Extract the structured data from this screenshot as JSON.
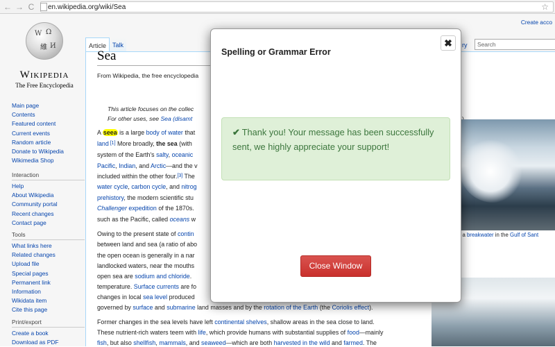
{
  "browser": {
    "url": "en.wikipedia.org/wiki/Sea",
    "back": "←",
    "forward": "→",
    "reload": "C",
    "star": "☆"
  },
  "header": {
    "create_account": "Create acco",
    "search_placeholder": "Search"
  },
  "logo": {
    "wordmark": "Wikipedia",
    "tagline": "The Free Encyclopedia"
  },
  "tabs": {
    "article": "Article",
    "talk": "Talk",
    "history": "ry"
  },
  "sidebar": {
    "main": [
      "Main page",
      "Contents",
      "Featured content",
      "Current events",
      "Random article",
      "Donate to Wikipedia",
      "Wikimedia Shop"
    ],
    "interaction_head": "Interaction",
    "interaction": [
      "Help",
      "About Wikipedia",
      "Community portal",
      "Recent changes",
      "Contact page"
    ],
    "tools_head": "Tools",
    "tools": [
      "What links here",
      "Related changes",
      "Upload file",
      "Special pages",
      "Permanent link",
      "Information",
      "Wikidata item",
      "Cite this page"
    ],
    "print_head": "Print/export",
    "print": [
      "Create a book",
      "Download as PDF"
    ]
  },
  "article": {
    "title": "Sea",
    "from": "From Wikipedia, the free encyclopedia",
    "hatnote1": "This article focuses on the collec",
    "hatnote2a": "For other uses, see ",
    "hatnote2b": "Sea (disamt",
    "hatnote_end": ").",
    "lines": {
      "l1a": "A ",
      "l1hl": "seea",
      "l1b": " is a large ",
      "l1c": "body of water",
      "l1d": " that",
      "l2a": "land",
      "l2b": " [1]",
      "l2c": " More broadly, ",
      "l2d": "the sea",
      "l2e": " (with",
      "l3a": "system of the Earth's ",
      "l3b": "salty",
      "l3c": ", ",
      "l3d": "oceanic",
      "l4a": "Pacific",
      "l4b": ", ",
      "l4c": "Indian",
      "l4d": ", and ",
      "l4e": "Arctic",
      "l4f": "—and the v",
      "l5a": "included within the other four.",
      "l5b": "[3]",
      "l5c": " The",
      "l6a": "water cycle",
      "l6b": ", ",
      "l6c": "carbon cycle",
      "l6d": ", and ",
      "l6e": "nitrog",
      "l7a": "prehistory",
      "l7b": ", the modern scientific stu",
      "l8a": "Challenger",
      "l8b": " expedition",
      "l8c": " of the 1870s.",
      "l9a": "such as the Pacific, called ",
      "l9b": "oceans",
      "l9c": " w",
      "p2l1a": "Owing to the present state of ",
      "p2l1b": "contin",
      "p2l2": "between land and sea (a ratio of abo",
      "p2l3": "the open ocean is generally in a nar",
      "p2l4": "landlocked waters, near the mouths",
      "p2l5a": "open sea are ",
      "p2l5b": "sodium and chloride",
      "p2l5c": ". ",
      "p2l6a": "temperature. ",
      "p2l6b": "Surface currents",
      "p2l6c": " are fo",
      "p2l7a": "changes in local ",
      "p2l7b": "sea level",
      "p2l7c": " produced",
      "p2l8a": "governed by ",
      "p2l8b": "surface",
      "p2l8c": " and ",
      "p2l8d": "submarine",
      "p2l8e": " land masses and by the ",
      "p2l8f": "rotation of the Earth",
      "p2l8g": " (the ",
      "p2l8h": "Coriolis effect",
      "p2l8i": ").",
      "p3l1a": "Former changes in the sea levels have left ",
      "p3l1b": "continental shelves",
      "p3l1c": ", shallow areas in the sea close to land.",
      "p3l2a": "These nutrient-rich waters teem with ",
      "p3l2b": "life",
      "p3l2c": ", which provide humans with substantial supplies of ",
      "p3l2d": "food",
      "p3l2e": "—mainly",
      "p3l3a": "fish",
      "p3l3b": ", but also ",
      "p3l3c": "shellfish",
      "p3l3d": ", ",
      "p3l3e": "mammals",
      "p3l3f": ", and ",
      "p3l3g": "seaweed",
      "p3l3h": "—which are both ",
      "p3l3i": "harvested in the wild",
      "p3l3j": " and ",
      "p3l3k": "farmed",
      "p3l3l": ". The"
    },
    "caption_a": "g a ",
    "caption_b": "breakwater",
    "caption_c": " in the ",
    "caption_d": "Gulf of Sant"
  },
  "modal": {
    "title": "Spelling or Grammar Error",
    "close_x": "✖",
    "check": "✔",
    "message": "Thank you! Your message has been successfully sent, we highly appreciate your support!",
    "close_button": "Close Window"
  },
  "colors": {
    "link": "#0645ad",
    "alert_bg": "#dff0d8",
    "alert_text": "#3c763d",
    "danger": "#d9534f"
  }
}
